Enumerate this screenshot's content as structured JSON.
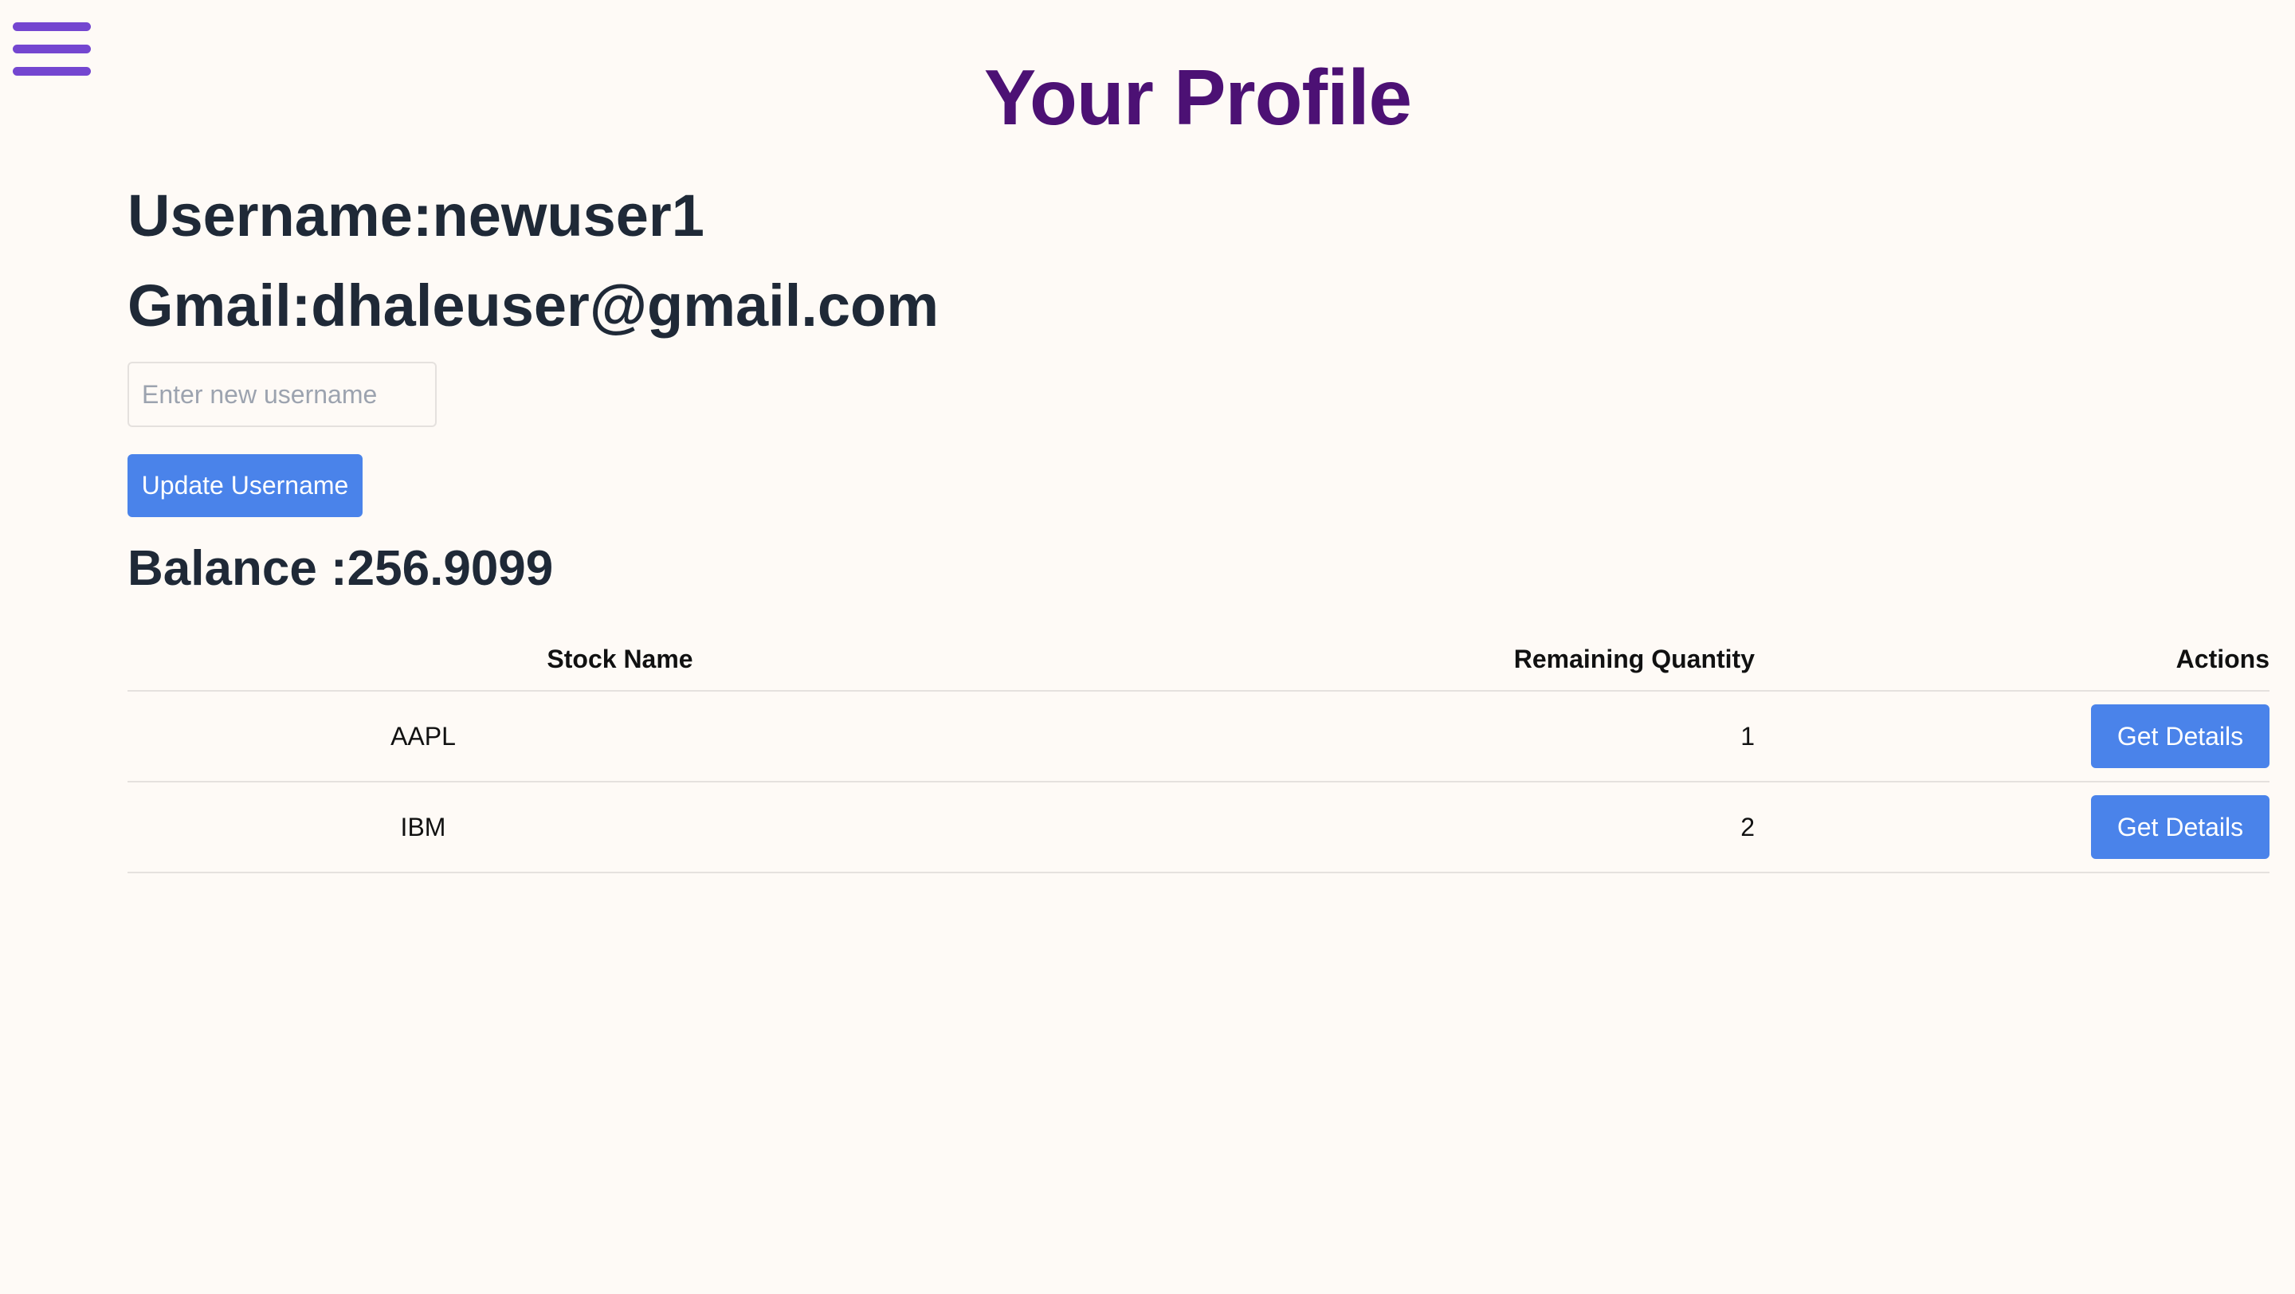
{
  "header": {
    "menu_icon": "hamburger-menu-icon",
    "title": "Your Profile"
  },
  "profile": {
    "username_line": "Username:newuser1",
    "gmail_line": "Gmail:dhaleuser@gmail.com",
    "username_input": {
      "value": "",
      "placeholder": "Enter new username"
    },
    "update_button_label": "Update Username",
    "balance_line": "Balance :256.9099"
  },
  "stocks_table": {
    "columns": [
      "Stock Name",
      "Remaining Quantity",
      "Actions"
    ],
    "rows": [
      {
        "stock_name": "AAPL",
        "remaining_quantity": "1",
        "action_label": "Get Details"
      },
      {
        "stock_name": "IBM",
        "remaining_quantity": "2",
        "action_label": "Get Details"
      }
    ]
  },
  "colors": {
    "background": "#fefaf6",
    "title": "#4c1174",
    "menu_icon": "#7446d0",
    "primary_button": "#4a83ea",
    "text": "#1f2937"
  }
}
